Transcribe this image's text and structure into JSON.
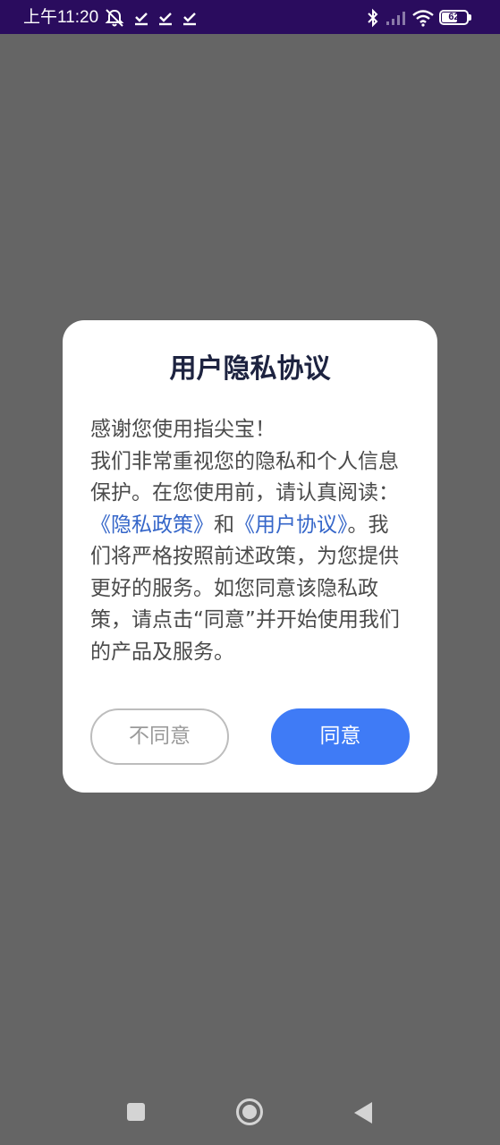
{
  "status_bar": {
    "time": "上午11:20",
    "battery_level": "62",
    "battery_fraction": 0.62,
    "icons": [
      "notifications-off-icon",
      "check-icon",
      "check-icon",
      "check-icon",
      "bluetooth-icon",
      "signal-icon",
      "wifi-icon",
      "battery-icon"
    ]
  },
  "dialog": {
    "title": "用户隐私协议",
    "greeting": "感谢您使用指尖宝！",
    "body_part1": "我们非常重视您的隐私和个人信息保护。在您使用前，请认真阅读：",
    "privacy_policy_link": "《隐私政策》",
    "conjunction": "和",
    "user_agreement_link": "《用户协议》",
    "body_part2": "。我们将严格按照前述政策，为您提供更好的服务。如您同意该隐私政策，请点击“同意”并开始使用我们的产品及服务。",
    "disagree_label": "不同意",
    "agree_label": "同意"
  },
  "colors": {
    "status_bar_bg": "#2a0c5e",
    "scrim": "#656565",
    "link": "#3566c9",
    "primary_button": "#3f7bf6",
    "title": "#1d2340"
  },
  "navigation": {
    "icons": [
      "recent-apps-icon",
      "home-icon",
      "back-icon"
    ]
  }
}
